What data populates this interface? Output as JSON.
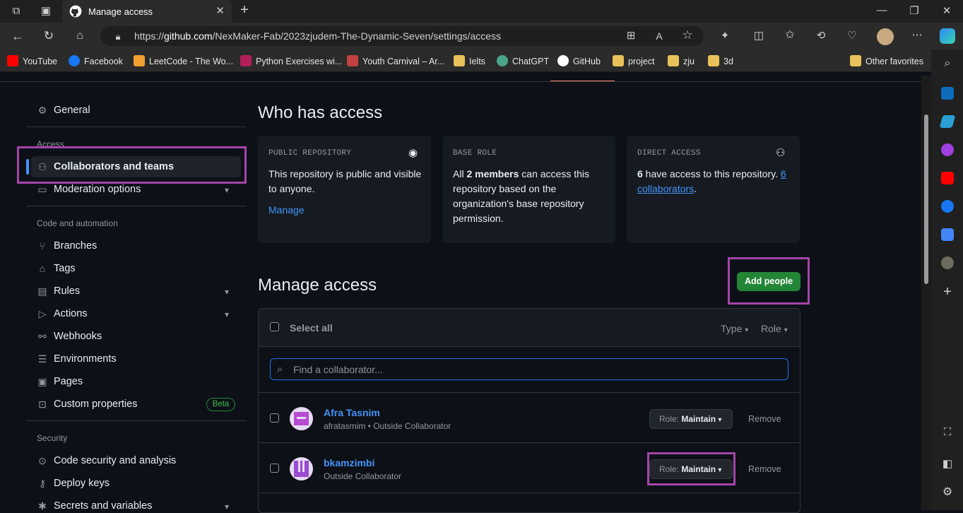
{
  "browser": {
    "tab_title": "Manage access",
    "url_prefix": "https://",
    "url_host": "github.com",
    "url_path": "/NexMaker-Fab/2023zjudem-The-Dynamic-Seven/settings/access",
    "bookmarks": [
      "YouTube",
      "Facebook",
      "LeetCode - The Wo...",
      "Python Exercises wi...",
      "Youth Carnival – Ar...",
      "Ielts",
      "ChatGPT",
      "GitHub",
      "project",
      "zju",
      "3d"
    ],
    "other_favorites": "Other favorites"
  },
  "sidebar": {
    "general": "General",
    "access_heading": "Access",
    "collaborators": "Collaborators and teams",
    "moderation": "Moderation options",
    "code_heading": "Code and automation",
    "branches": "Branches",
    "tags": "Tags",
    "rules": "Rules",
    "actions": "Actions",
    "webhooks": "Webhooks",
    "environments": "Environments",
    "pages": "Pages",
    "custom_properties": "Custom properties",
    "beta": "Beta",
    "security_heading": "Security",
    "code_security": "Code security and analysis",
    "deploy_keys": "Deploy keys",
    "secrets": "Secrets and variables"
  },
  "who": {
    "title": "Who has access",
    "public_label": "PUBLIC REPOSITORY",
    "public_text": "This repository is public and visible to anyone.",
    "manage_link": "Manage",
    "base_label": "BASE ROLE",
    "base_pre": "All ",
    "base_bold": "2 members",
    "base_post": " can access this repository based on the organization's base repository permission.",
    "direct_label": "DIRECT ACCESS",
    "direct_bold": "6",
    "direct_mid": " have access to this repository. ",
    "direct_link": "6 collaborators",
    "direct_end": "."
  },
  "manage": {
    "title": "Manage access",
    "add_people": "Add people",
    "select_all": "Select all",
    "type_filter": "Type",
    "role_filter": "Role",
    "search_placeholder": "Find a collaborator..."
  },
  "collaborators": [
    {
      "name": "Afra Tasnim",
      "sub": "afratasmim • Outside Collaborator",
      "role_prefix": "Role: ",
      "role": "Maintain",
      "remove": "Remove"
    },
    {
      "name": "bkamzimbi",
      "sub": "Outside Collaborator",
      "role_prefix": "Role: ",
      "role": "Maintain",
      "remove": "Remove"
    }
  ],
  "colors": {
    "accent_green": "#238636",
    "link_blue": "#4493f8",
    "highlight": "#a544a8"
  }
}
